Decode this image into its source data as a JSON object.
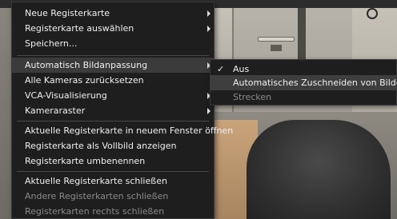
{
  "menu": {
    "items": [
      {
        "label": "Neue Registerkarte",
        "has_submenu": true,
        "disabled": false
      },
      {
        "label": "Registerkarte auswählen",
        "has_submenu": true,
        "disabled": false
      },
      {
        "label": "Speichern...",
        "has_submenu": false,
        "disabled": false
      },
      {
        "label": "Automatisch Bildanpassung",
        "has_submenu": true,
        "disabled": false
      },
      {
        "label": "Alle Kameras zurücksetzen",
        "has_submenu": false,
        "disabled": false
      },
      {
        "label": "VCA-Visualisierung",
        "has_submenu": true,
        "disabled": false
      },
      {
        "label": "Kameraraster",
        "has_submenu": true,
        "disabled": false
      },
      {
        "label": "Aktuelle Registerkarte in neuem Fenster öffnen",
        "has_submenu": false,
        "disabled": false
      },
      {
        "label": "Registerkarte als Vollbild anzeigen",
        "has_submenu": false,
        "disabled": false
      },
      {
        "label": "Registerkarte umbenennen",
        "has_submenu": false,
        "disabled": false
      },
      {
        "label": "Aktuelle Registerkarte schließen",
        "has_submenu": false,
        "disabled": false
      },
      {
        "label": "Andere Registerkarten schließen",
        "has_submenu": false,
        "disabled": true
      },
      {
        "label": "Registerkarten rechts schließen",
        "has_submenu": false,
        "disabled": true
      }
    ]
  },
  "submenu": {
    "items": [
      {
        "label": "Aus",
        "checked": true,
        "disabled": false
      },
      {
        "label": "Automatisches Zuschneiden von Bildern",
        "checked": false,
        "disabled": false
      },
      {
        "label": "Strecken",
        "checked": false,
        "disabled": true
      }
    ]
  },
  "icons": {
    "check": "✓",
    "submenu_arrow": "chevron-right-icon"
  },
  "colors": {
    "menu_bg": "#1e1e1e",
    "highlight": "#3b3b3b",
    "text": "#f0f0f0",
    "disabled_text": "#8b8b8b"
  }
}
